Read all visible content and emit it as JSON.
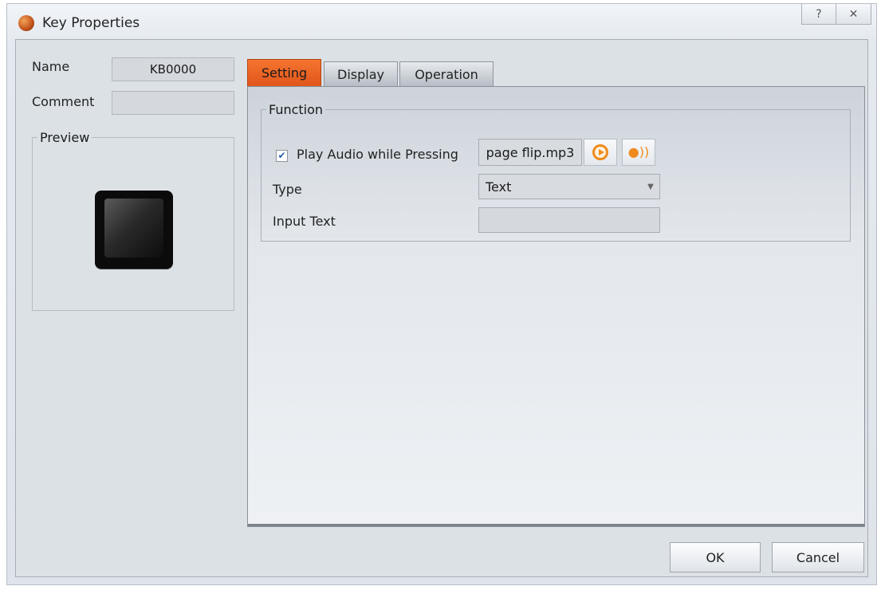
{
  "window": {
    "title": "Key Properties",
    "help_glyph": "?",
    "close_glyph": "✕"
  },
  "left": {
    "name_label": "Name",
    "name_value": "KB0000",
    "comment_label": "Comment",
    "comment_value": "",
    "preview_label": "Preview"
  },
  "tabs": [
    {
      "label": "Setting",
      "active": true
    },
    {
      "label": "Display",
      "active": false
    },
    {
      "label": "Operation",
      "active": false
    }
  ],
  "function": {
    "group_label": "Function",
    "play_audio_label": "Play Audio while Pressing",
    "play_audio_checked": true,
    "checkmark": "✔",
    "audio_file": "page flip.mp3",
    "type_label": "Type",
    "type_value": "Text",
    "dropdown_glyph": "▼",
    "input_text_label": "Input Text",
    "input_text_value": ""
  },
  "footer": {
    "ok_label": "OK",
    "cancel_label": "Cancel"
  },
  "colors": {
    "accent_tab": "#e95f21",
    "audio_icon": "#f08a1c"
  }
}
